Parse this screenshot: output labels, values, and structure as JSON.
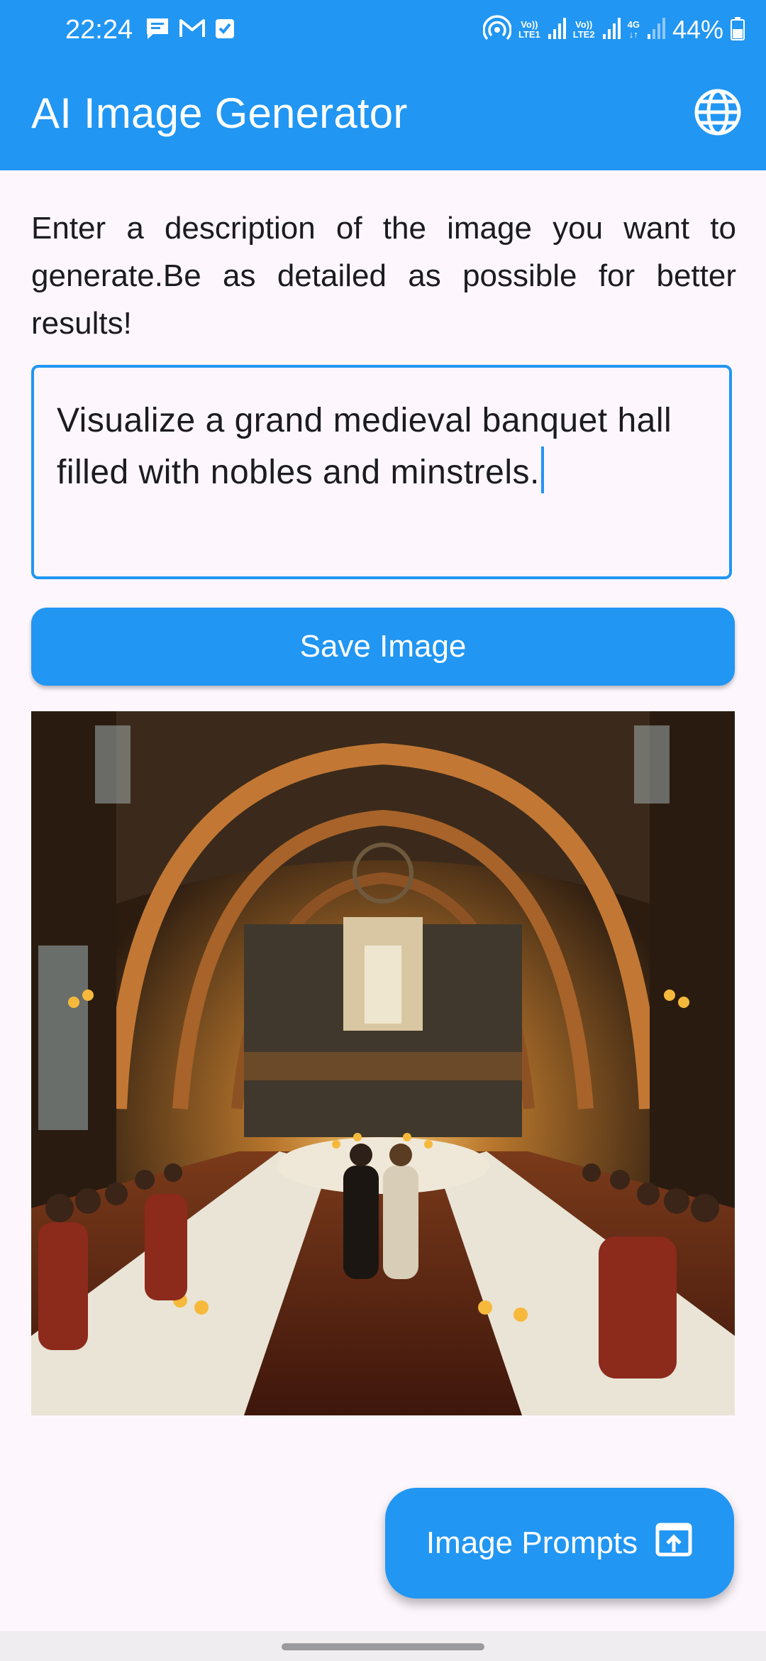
{
  "status_bar": {
    "time": "22:24",
    "left_icons": [
      "message-icon",
      "gmail-icon",
      "check-box-icon"
    ],
    "right_icons": [
      "hotspot-icon",
      "volte-lte1-icon",
      "signal-icon",
      "volte-lte2-icon",
      "signal-icon",
      "4g-data-icon",
      "signal-weak-icon",
      "battery-icon"
    ],
    "volte1": "Vo))",
    "lte1": "LTE1",
    "volte2": "Vo))",
    "lte2": "LTE2",
    "network": "4G",
    "battery": "44%"
  },
  "app_bar": {
    "title": "AI Image Generator",
    "action_icon": "globe-icon"
  },
  "instructions": "Enter a description of the image you want to generate.Be as detailed as possible for better results!",
  "prompt_input": {
    "value": "Visualize a grand medieval banquet hall filled with nobles and minstrels."
  },
  "save_button": {
    "label": "Save Image"
  },
  "generated_image": {
    "subject": "medieval-banquet-hall"
  },
  "fab": {
    "label": "Image Prompts",
    "icon": "open-in-app-icon"
  },
  "colors": {
    "primary": "#2196f3",
    "background": "#fdf7fd",
    "on_primary": "#ffffff",
    "text": "#1c1b1f"
  }
}
